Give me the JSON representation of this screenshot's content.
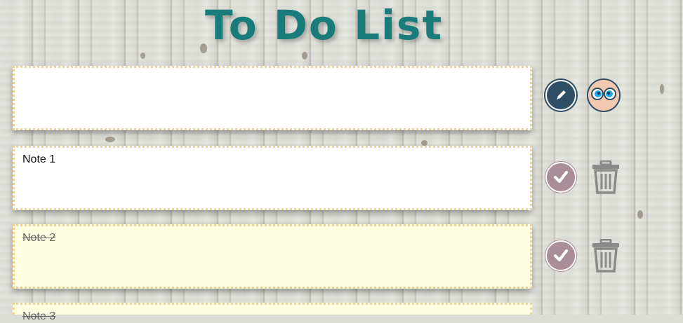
{
  "app": {
    "title": "To Do List"
  },
  "new_note": {
    "value": ""
  },
  "notes": [
    {
      "text": "Note 1",
      "done": false
    },
    {
      "text": "Note 2",
      "done": true
    },
    {
      "text": "Note 3",
      "done": true
    }
  ],
  "colors": {
    "title": "#1a7b7b",
    "note_border": "#f3d28c",
    "note_done_bg": "#fffde0",
    "edit_button": "#2f4f66",
    "check_button": "#a98d98",
    "trash": "#8a8a8a"
  },
  "icons": {
    "edit": "pencil-icon",
    "avatar": "avatar-glasses-icon",
    "check": "checkmark-icon",
    "delete": "trash-icon"
  }
}
